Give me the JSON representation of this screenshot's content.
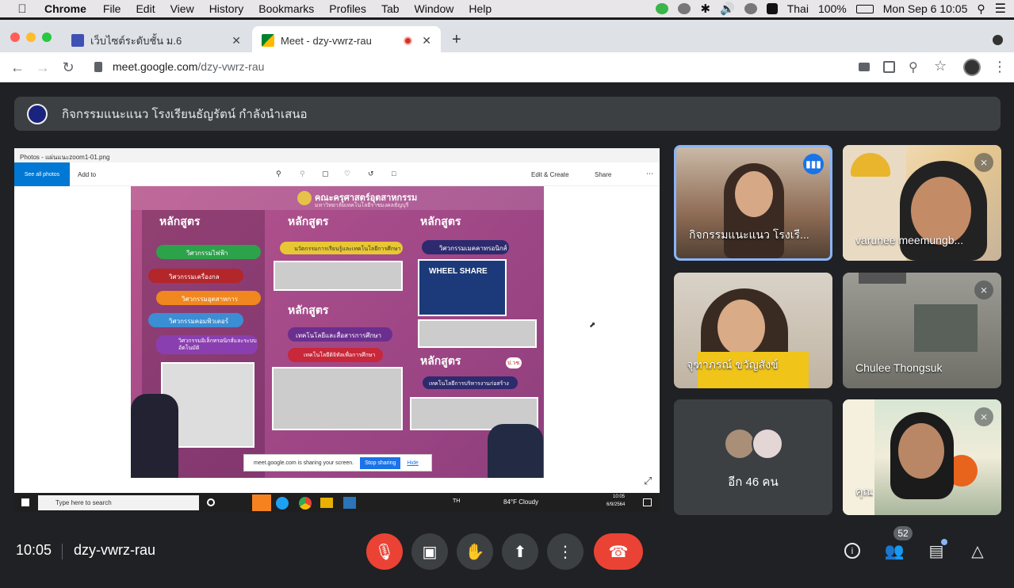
{
  "menubar": {
    "app": "Chrome",
    "items": [
      "File",
      "Edit",
      "View",
      "History",
      "Bookmarks",
      "Profiles",
      "Tab",
      "Window",
      "Help"
    ],
    "input_source": "Thai",
    "battery": "100%",
    "datetime": "Mon Sep 6  10:05"
  },
  "tabs": [
    {
      "title": "เว็บไซต์ระดับชั้น ม.6",
      "active": false
    },
    {
      "title": "Meet - dzy-vwrz-rau",
      "active": true
    }
  ],
  "address": {
    "host": "meet.google.com",
    "path": "/dzy-vwrz-rau"
  },
  "presenting": {
    "text": "กิจกรรมแนะแนว โรงเรียนธัญรัตน์ กำลังนำเสนอ"
  },
  "shared_screen": {
    "photos_title": "Photos - แผ่นแนะzoom1-01.png",
    "see_all": "See all photos",
    "add_to": "Add to",
    "edit_create": "Edit & Create",
    "share": "Share",
    "taskbar_search": "Type here to search",
    "weather": "84°F  Cloudy",
    "lang": "TH",
    "tray_time": "10:05",
    "tray_date": "6/9/2564",
    "sharing_note": "meet.google.com is sharing your screen.",
    "stop_sharing": "Stop sharing",
    "hide": "Hide",
    "poster": {
      "header": "คณะครุศาสตร์อุตสาหกรรม",
      "subheader": "มหาวิทยาลัยเทคโนโลยีราชมงคลธัญบุรี",
      "col1_title": "หลักสูตร",
      "col2_title": "หลักสูตร",
      "col3_title": "หลักสูตร",
      "col1_items": [
        "วิศวกรรมไฟฟ้า",
        "วิศวกรรมเครื่องกล",
        "วิศวกรรมอุตสาหการ",
        "วิศวกรรมคอมพิวเตอร์",
        "วิศวกรรมอิเล็กทรอนิกส์และระบบอัตโนมัติ"
      ],
      "col2_items": [
        "นวัตกรรมการเรียนรู้และเทคโนโลยีการศึกษา",
        "เทคโนโลยีและสื่อสารการศึกษา",
        "เทคโนโลยีดิจิทัลเพื่อการศึกษา"
      ],
      "col3_items": [
        "วิศวกรรมเมคคาทรอนิกส์",
        "เทคโนโลยีการบริหารงานก่อสร้าง"
      ],
      "badge": "ป.วช.",
      "wheel": "WHEEL SHARE"
    }
  },
  "participants": [
    {
      "name": "กิจกรรมแนะแนว โรงเรี...",
      "speaking": true,
      "muted": false
    },
    {
      "name": "varunee meemungb...",
      "speaking": false,
      "muted": true
    },
    {
      "name": "จุฑาภรณ์ ขวัญสังข์",
      "speaking": false,
      "muted": false
    },
    {
      "name": "Chulee Thongsuk",
      "speaking": false,
      "muted": true
    },
    {
      "name": "อีก 46 คน",
      "speaking": false,
      "muted": false
    },
    {
      "name": "คุณ",
      "speaking": false,
      "muted": true
    }
  ],
  "bottom": {
    "time": "10:05",
    "meeting_code": "dzy-vwrz-rau",
    "participant_count": "52"
  },
  "colors": {
    "meet_bg": "#202124",
    "tile_bg": "#3c4043",
    "end_red": "#ea4335",
    "accent_blue": "#8ab4f8"
  }
}
